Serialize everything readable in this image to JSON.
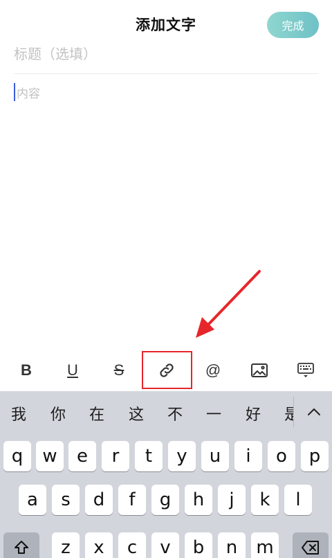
{
  "header": {
    "title": "添加文字",
    "done_label": "完成",
    "accent": "#6ec1c6"
  },
  "editor": {
    "title_placeholder": "标题（选填）",
    "content_placeholder": "内容"
  },
  "toolbar": {
    "bold": "B",
    "underline": "U",
    "strike": "S",
    "mention": "@",
    "icons": [
      "bold",
      "underline",
      "strikethrough",
      "link-icon",
      "at-icon",
      "image-icon",
      "keyboard-hide-icon"
    ]
  },
  "annotation": {
    "highlight_color": "#e6262a",
    "highlighted_tool": "link-icon"
  },
  "keyboard": {
    "candidates": [
      "我",
      "你",
      "在",
      "这",
      "不",
      "一",
      "好",
      "是"
    ],
    "row1": [
      "q",
      "w",
      "e",
      "r",
      "t",
      "y",
      "u",
      "i",
      "o",
      "p"
    ],
    "row2": [
      "a",
      "s",
      "d",
      "f",
      "g",
      "h",
      "j",
      "k",
      "l"
    ],
    "row3": [
      "z",
      "x",
      "c",
      "v",
      "b",
      "n",
      "m"
    ]
  }
}
